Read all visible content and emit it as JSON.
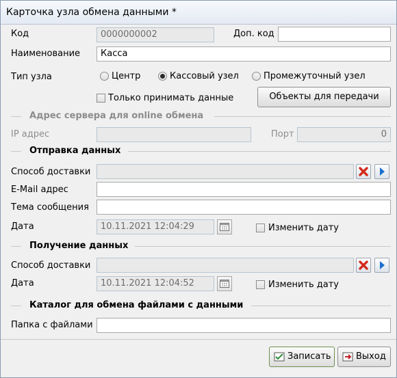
{
  "window": {
    "title": "Карточка узла обмена данными *"
  },
  "code": {
    "label": "Код",
    "value": "0000000002"
  },
  "extra_code": {
    "label": "Доп. код",
    "value": ""
  },
  "name": {
    "label": "Наименование",
    "value": "Касса"
  },
  "node_type": {
    "label": "Тип узла",
    "options": [
      {
        "label": "Центр",
        "selected": false
      },
      {
        "label": "Кассовый узел",
        "selected": true
      },
      {
        "label": "Промежуточный узел",
        "selected": false
      }
    ]
  },
  "receive_only": {
    "label": "Только принимать данные",
    "checked": false
  },
  "objects_button": {
    "label": "Объекты для передачи"
  },
  "online": {
    "title": "Адрес сервера для online обмена",
    "ip_label": "IP адрес",
    "ip_value": "",
    "port_label": "Порт",
    "port_value": "0"
  },
  "send": {
    "title": "Отправка данных",
    "delivery_label": "Способ доставки",
    "delivery_value": "",
    "email_label": "E-Mail адрес",
    "email_value": "",
    "subject_label": "Тема сообщения",
    "subject_value": "",
    "date_label": "Дата",
    "date_value": "10.11.2021 12:04:29",
    "change_date_label": "Изменить дату"
  },
  "receive": {
    "title": "Получение данных",
    "delivery_label": "Способ доставки",
    "delivery_value": "",
    "date_label": "Дата",
    "date_value": "10.11.2021 12:04:52",
    "change_date_label": "Изменить дату"
  },
  "catalog": {
    "title": "Каталог для обмена файлами с данными",
    "folder_label": "Папка с файлами",
    "folder_value": ""
  },
  "footer": {
    "save_label": "Записать",
    "exit_label": "Выход"
  },
  "colors": {
    "clear_icon": "#d42a1c",
    "select_icon": "#1a6fcf",
    "save_icon": "#2e8b3a",
    "exit_icon": "#c0262d"
  }
}
